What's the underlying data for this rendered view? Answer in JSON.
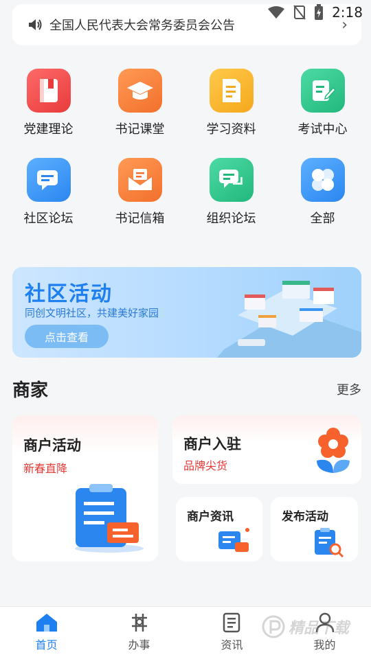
{
  "status": {
    "time": "2:18"
  },
  "notice": {
    "text": "全国人民代表大会常务委员会公告"
  },
  "grid": [
    {
      "label": "党建理论",
      "icon": "party-book-icon",
      "color": "#f04a4a"
    },
    {
      "label": "书记课堂",
      "icon": "graduation-cap-icon",
      "color": "#f5823a"
    },
    {
      "label": "学习资料",
      "icon": "document-icon",
      "color": "#f7b42a"
    },
    {
      "label": "考试中心",
      "icon": "exam-edit-icon",
      "color": "#2fc58e"
    },
    {
      "label": "社区论坛",
      "icon": "chat-bubble-icon",
      "color": "#3a95f4"
    },
    {
      "label": "书记信箱",
      "icon": "mailbox-icon",
      "color": "#f5823a"
    },
    {
      "label": "组织论坛",
      "icon": "chat-bubbles-icon",
      "color": "#2fc58e"
    },
    {
      "label": "全部",
      "icon": "all-apps-icon",
      "color": "#3a95f4"
    }
  ],
  "banner": {
    "title": "社区活动",
    "subtitle": "同创文明社区，共建美好家园",
    "button": "点击查看"
  },
  "merchants": {
    "heading": "商家",
    "more": "更多",
    "activity": {
      "title": "商户活动",
      "subtitle": "新春直降"
    },
    "join": {
      "title": "商户入驻",
      "subtitle": "品牌尖货"
    },
    "news": {
      "title": "商户资讯"
    },
    "publish": {
      "title": "发布活动"
    }
  },
  "tabbar": [
    {
      "label": "首页",
      "icon": "home-icon",
      "active": true
    },
    {
      "label": "办事",
      "icon": "tasks-icon",
      "active": false
    },
    {
      "label": "资讯",
      "icon": "news-icon",
      "active": false
    },
    {
      "label": "我的",
      "icon": "user-icon",
      "active": false
    }
  ],
  "watermark": {
    "text": "精品下载"
  },
  "colors": {
    "accent": "#1e7ff0",
    "alert": "#e53935"
  }
}
